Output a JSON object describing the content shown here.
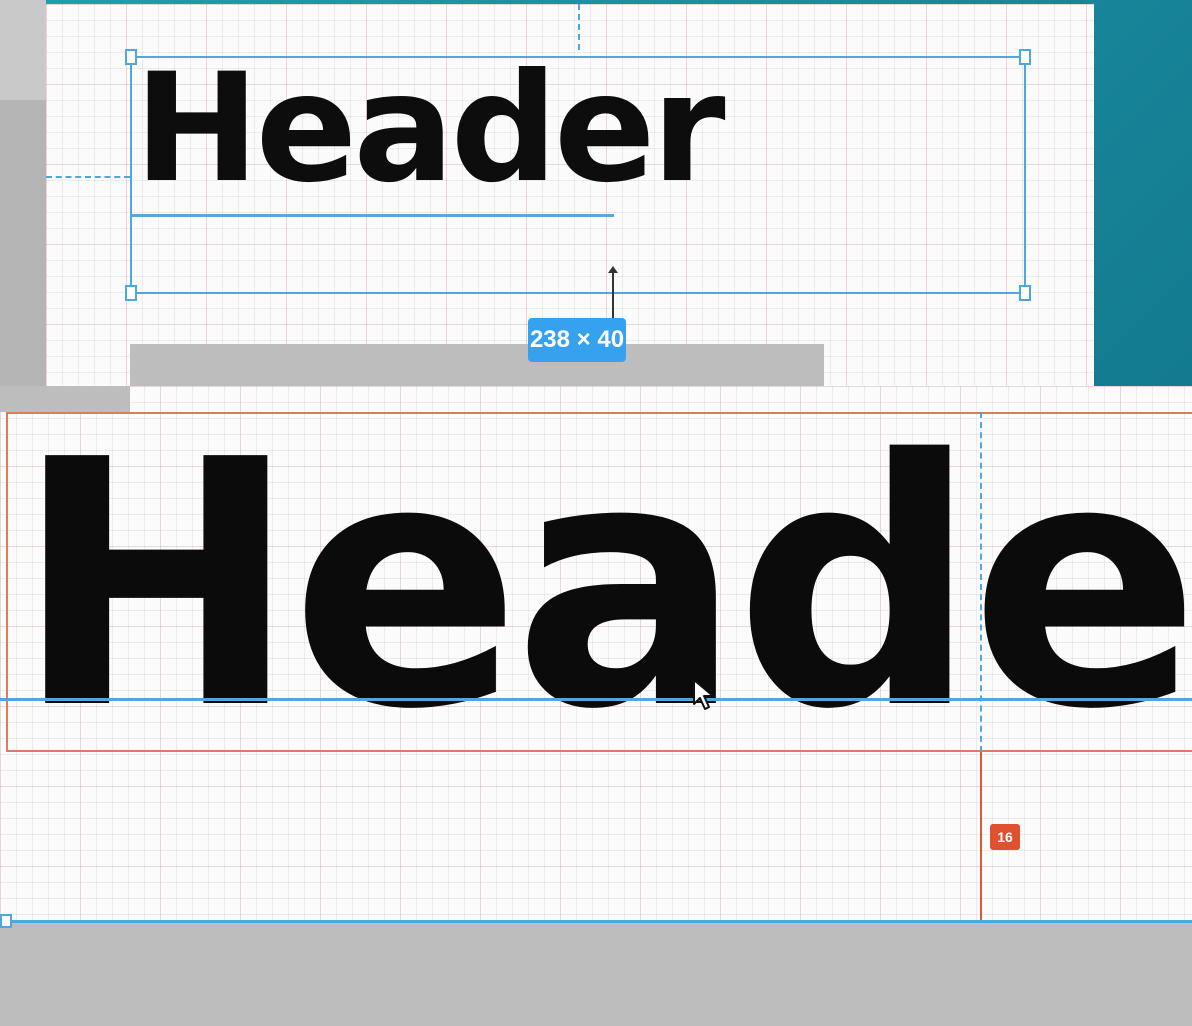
{
  "top_canvas": {
    "header_text": "Header",
    "dimension_badge": "238 × 40"
  },
  "bottom_canvas": {
    "header_text": "Heade",
    "spacing_badge": "16"
  },
  "colors": {
    "selection": "#4ea8e0",
    "badge_blue": "#36a2ef",
    "spacing_red": "#e0522f",
    "frame_outline": "#e07a5f",
    "background_teal": "#1a8fa0"
  },
  "icons": {
    "cursor": "arrow-cursor-icon",
    "measure": "measure-arrow-icon"
  }
}
